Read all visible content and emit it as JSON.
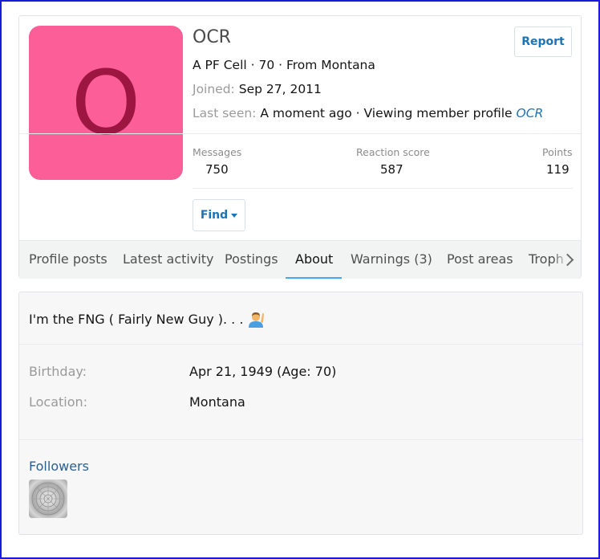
{
  "profile": {
    "avatar_letter": "O",
    "name": "OCR",
    "subtitle": "A PF Cell · 70 · From Montana",
    "joined_label": "Joined:",
    "joined_value": "Sep 27, 2011",
    "last_seen_label": "Last seen:",
    "last_seen_value": "A moment ago · Viewing member profile",
    "last_seen_link": "OCR",
    "report_label": "Report",
    "find_label": "Find",
    "colors": {
      "avatar_bg": "#fc5e97",
      "avatar_letter": "#9d1541",
      "link": "#1c74b5"
    }
  },
  "stats": [
    {
      "label": "Messages",
      "value": "750"
    },
    {
      "label": "Reaction score",
      "value": "587"
    },
    {
      "label": "Points",
      "value": "119"
    }
  ],
  "tabs": [
    {
      "label": "Profile posts"
    },
    {
      "label": "Latest activity"
    },
    {
      "label": "Postings"
    },
    {
      "label": "About"
    },
    {
      "label": "Warnings (3)"
    },
    {
      "label": "Post areas"
    },
    {
      "label": "Troph"
    }
  ],
  "active_tab": "About",
  "about": {
    "bio": "I'm the FNG ( Fairly New Guy ). . .",
    "bio_emoji": "man-raising-hand-emoji",
    "birthday_label": "Birthday:",
    "birthday_value": "Apr 21, 1949 (Age: 70)",
    "location_label": "Location:",
    "location_value": "Montana",
    "followers_label": "Followers"
  }
}
